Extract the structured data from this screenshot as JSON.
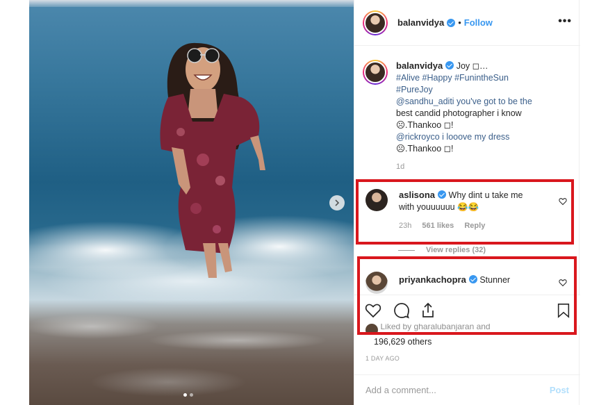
{
  "post": {
    "username": "balanvidya",
    "follow_label": "Follow",
    "separator": "•",
    "more_icon": "•••"
  },
  "caption": {
    "username": "balanvidya",
    "lines": [
      "Joy ◻…",
      "#Alive #Happy #FunintheSun",
      "#PureJoy",
      "@sandhu_aditi you've got to be the",
      "best candid photographer i know",
      "☹.Thankoo ◻!",
      "@rickroyco i looove my dress",
      "☹.Thankoo ◻!"
    ],
    "age": "1d"
  },
  "comments": [
    {
      "username": "aslisona",
      "text_line1": "Why dint u take me",
      "text_line2": "with youuuuuu 😂😂",
      "age": "23h",
      "likes": "561 likes",
      "reply_label": "Reply"
    },
    {
      "username": "priyankachopra",
      "text": "Stunner"
    }
  ],
  "view_replies": "View replies (32)",
  "likes": {
    "liked_by_text": "Liked by gharalubanjaran and",
    "count_text": "196,629 others"
  },
  "timestamp": "1 DAY AGO",
  "comment_box": {
    "placeholder": "Add a comment...",
    "post_label": "Post"
  },
  "colors": {
    "accent": "#3897f0",
    "highlight": "#d9171d",
    "muted": "#999999"
  },
  "icons": [
    "more-options-icon",
    "verified-icon",
    "heart-icon",
    "comment-icon",
    "share-icon",
    "bookmark-icon",
    "chevron-right-icon"
  ]
}
